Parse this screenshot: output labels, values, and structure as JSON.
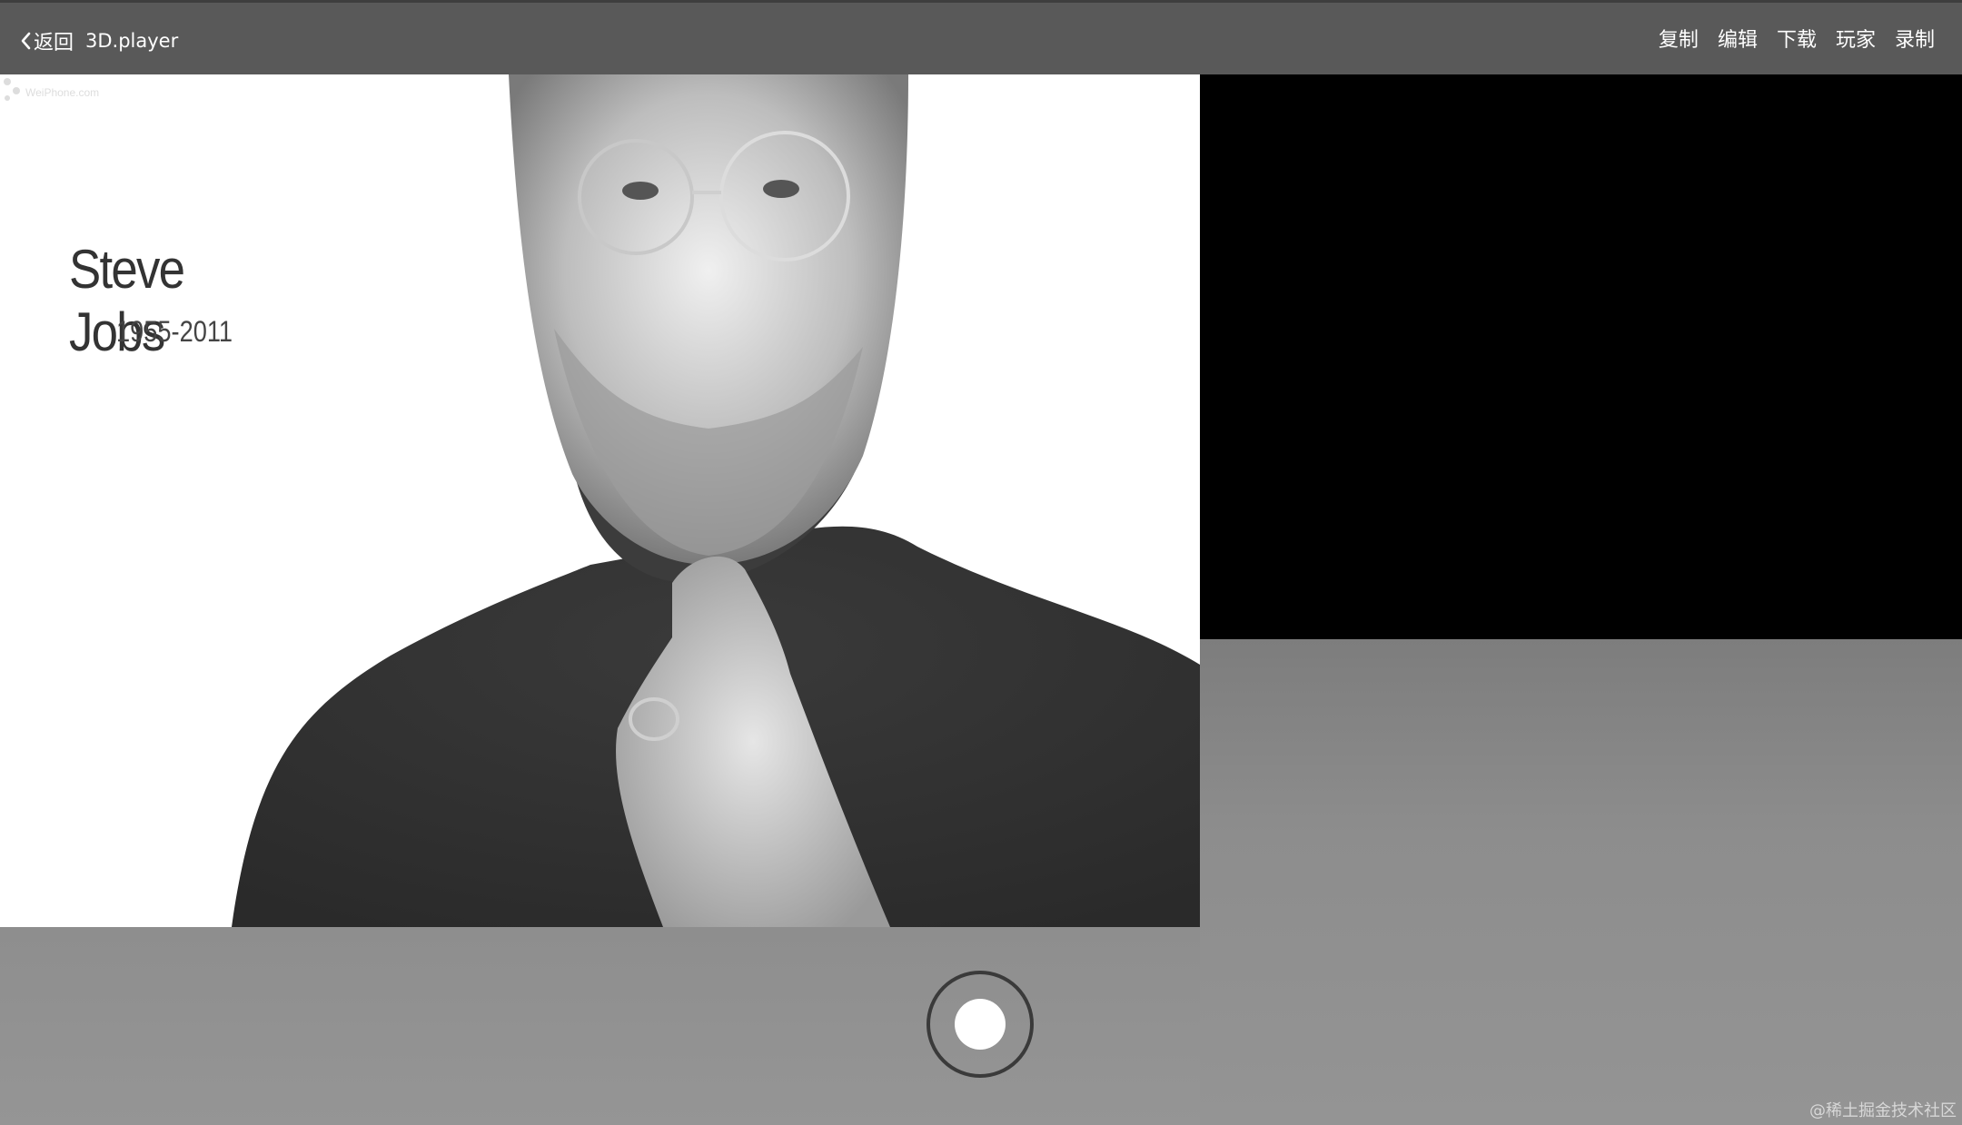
{
  "header": {
    "back_label": "返回",
    "app_title": "3D.player",
    "actions": [
      "复制",
      "编辑",
      "下载",
      "玩家",
      "录制"
    ]
  },
  "photo": {
    "title": "Steve Jobs",
    "years": "1955-2011",
    "watermark": "WeiPhone.com"
  },
  "credit": "@稀土掘金技术社区",
  "colors": {
    "topbar": "#595959",
    "wall": "#000000",
    "floor": "#8f8f8f",
    "record_ring": "#3a3a3a"
  },
  "icons": {
    "back": "chevron-left-icon",
    "record": "record-button-icon"
  }
}
